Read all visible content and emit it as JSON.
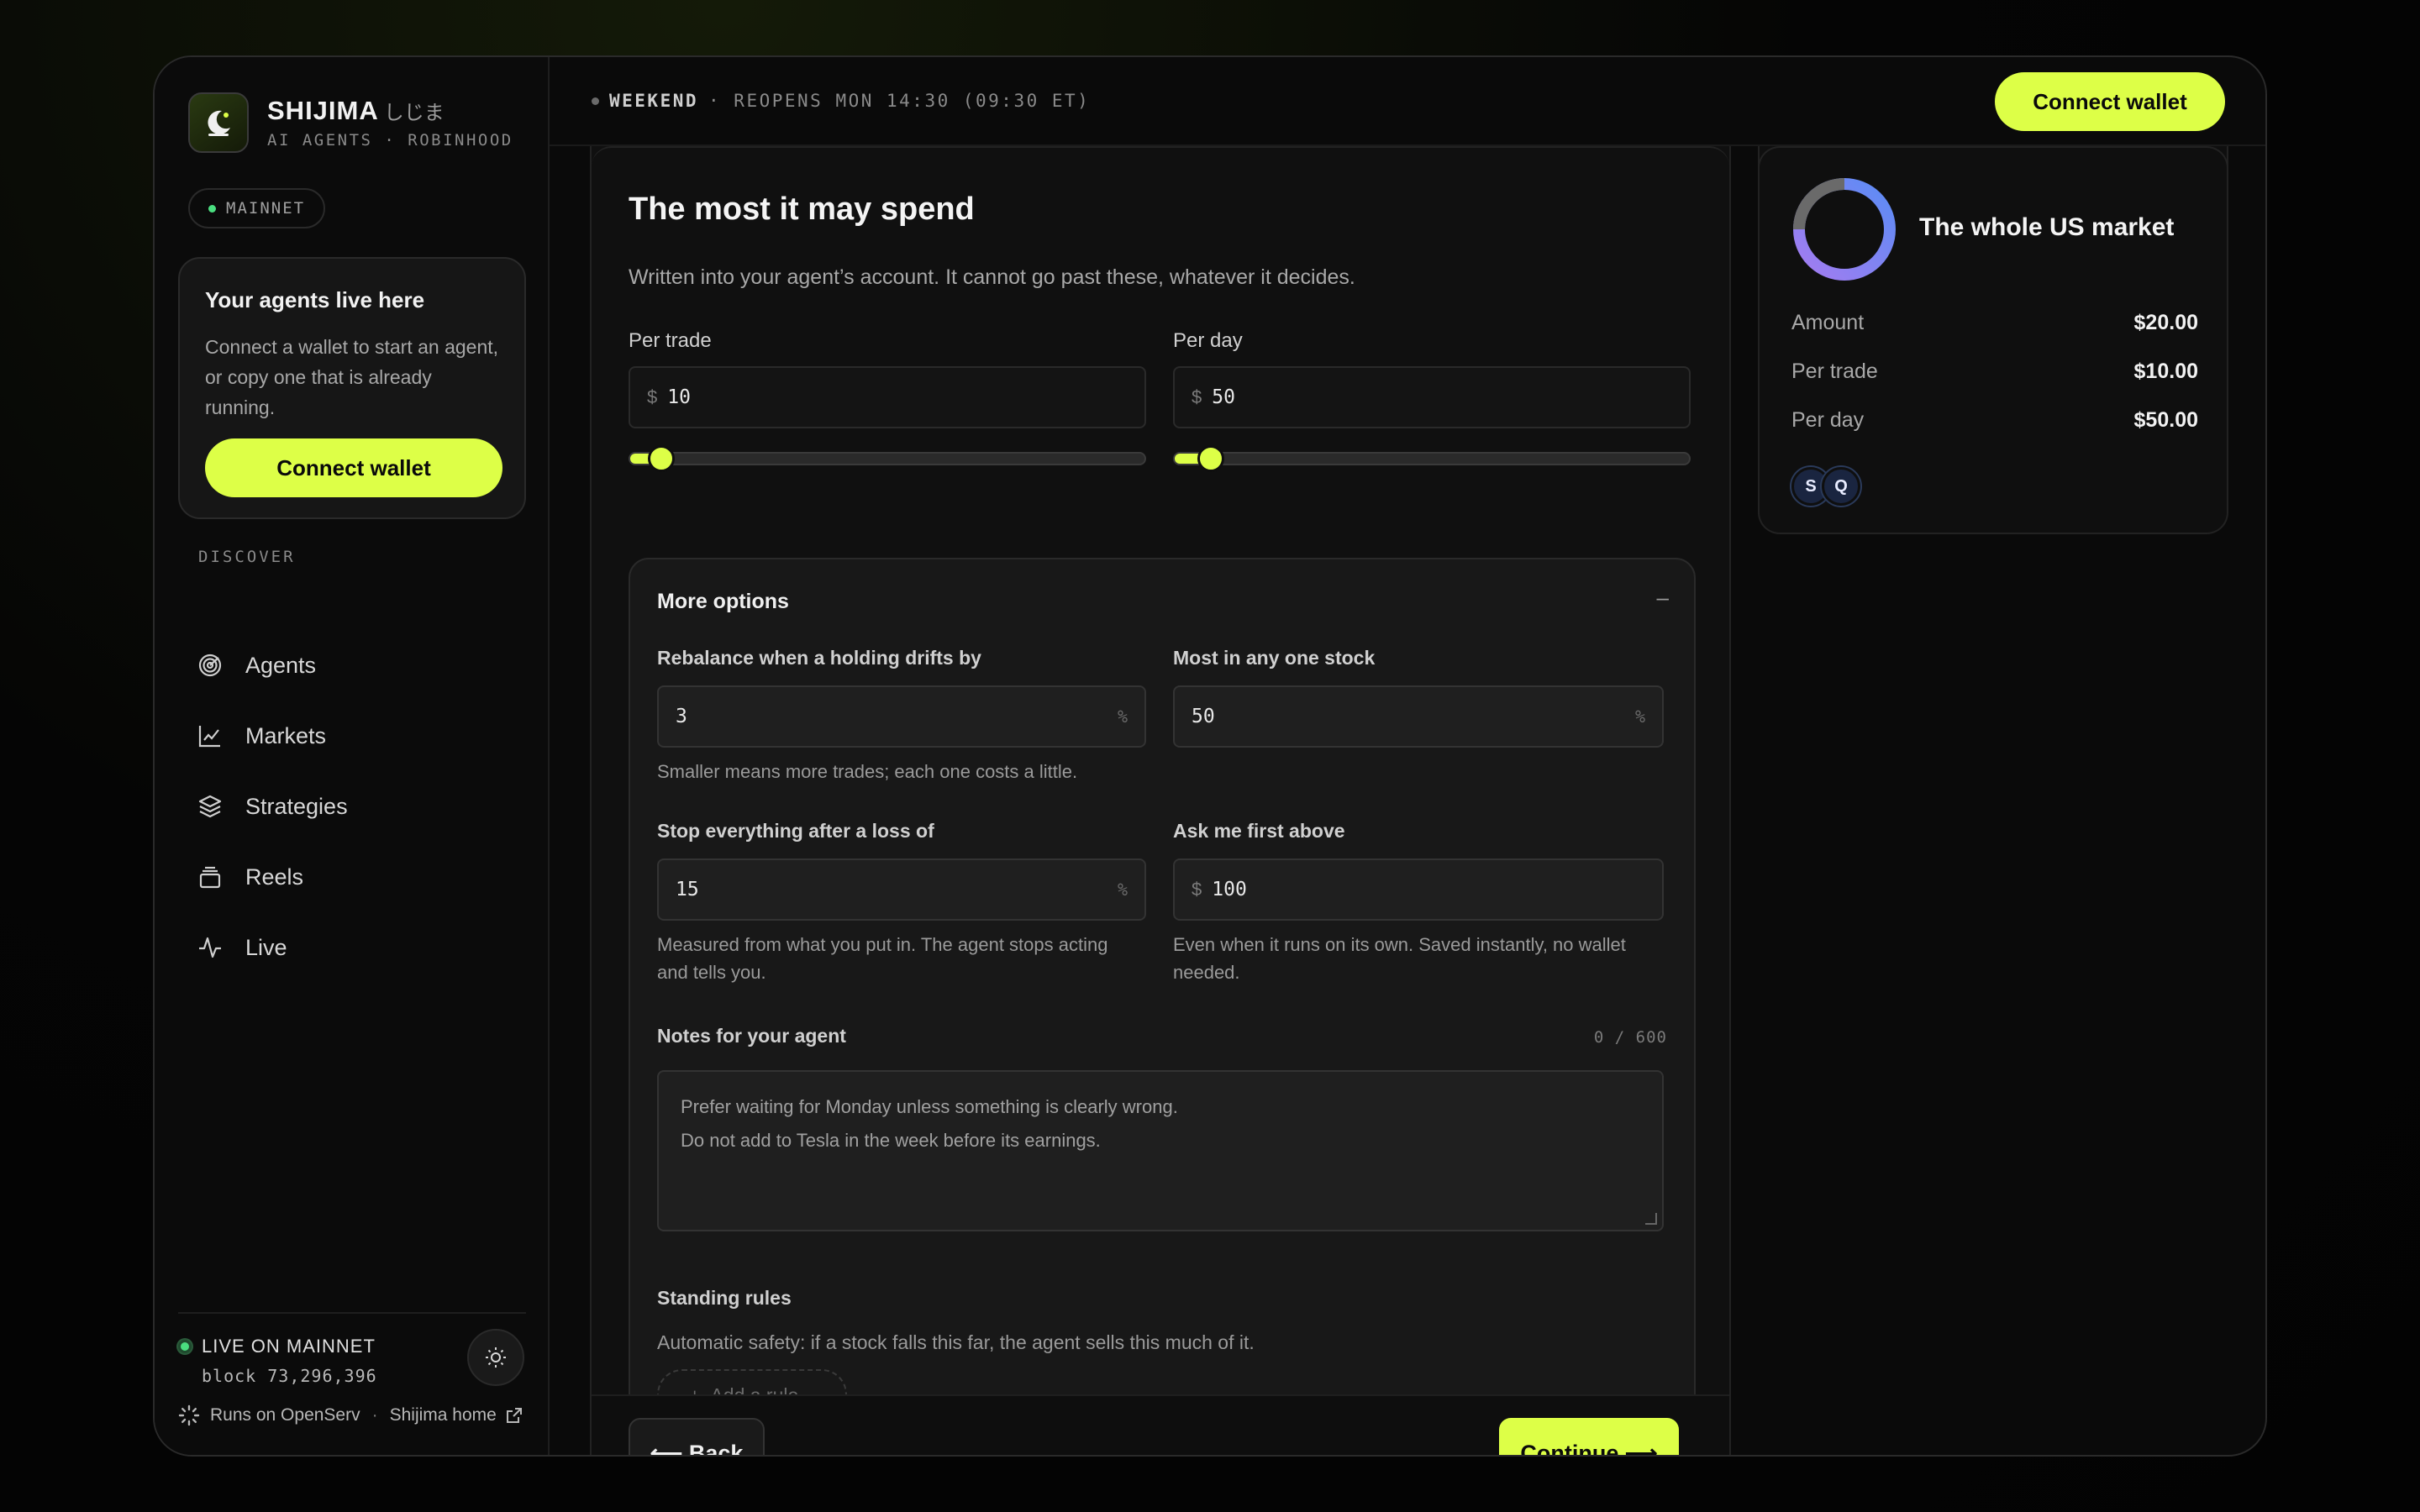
{
  "brand": {
    "name": "SHIJIMA",
    "jp": "しじま",
    "subtitle": "AI AGENTS · ROBINHOOD"
  },
  "network_badge": "MAINNET",
  "welcome": {
    "title": "Your agents live here",
    "text": "Connect a wallet to start an agent, or copy one that is already running.",
    "button": "Connect wallet"
  },
  "nav": {
    "section": "DISCOVER",
    "items": [
      {
        "label": "Agents",
        "icon": "radar-icon"
      },
      {
        "label": "Markets",
        "icon": "line-chart-icon"
      },
      {
        "label": "Strategies",
        "icon": "layers-icon"
      },
      {
        "label": "Reels",
        "icon": "stack-icon"
      },
      {
        "label": "Live",
        "icon": "pulse-icon"
      }
    ]
  },
  "status": {
    "live": "LIVE ON MAINNET",
    "block": "block 73,296,396"
  },
  "footer_links": {
    "openserv": "Runs on OpenServ",
    "home": "Shijima home"
  },
  "topbar": {
    "market_state": "WEEKEND",
    "reopens": "· REOPENS MON 14:30 (09:30 ET)",
    "connect": "Connect wallet"
  },
  "limits": {
    "title": "The most it may spend",
    "subtitle": "Written into your agent’s account. It cannot go past these, whatever it decides.",
    "per_trade": {
      "label": "Per trade",
      "prefix": "$",
      "value": "10",
      "slider_fraction": 0.06
    },
    "per_day": {
      "label": "Per day",
      "prefix": "$",
      "value": "50",
      "slider_fraction": 0.07
    }
  },
  "options": {
    "title": "More options",
    "collapse": "–",
    "rebalance": {
      "label": "Rebalance when a holding drifts by",
      "value": "3",
      "suffix": "%",
      "help": "Smaller means more trades; each one costs a little."
    },
    "max_stock": {
      "label": "Most in any one stock",
      "value": "50",
      "suffix": "%"
    },
    "stop_loss": {
      "label": "Stop everything after a loss of",
      "value": "15",
      "suffix": "%",
      "help": "Measured from what you put in. The agent stops acting and tells you."
    },
    "ask_above": {
      "label": "Ask me first above",
      "prefix": "$",
      "value": "100",
      "help": "Even when it runs on its own. Saved instantly, no wallet needed."
    },
    "notes": {
      "label": "Notes for your agent",
      "counter": "0 / 600",
      "placeholder_line1": "Prefer waiting for Monday unless something is clearly wrong.",
      "placeholder_line2": "Do not add to Tesla in the week before its earnings."
    },
    "standing_rules": {
      "label": "Standing rules",
      "help": "Automatic safety: if a stock falls this far, the agent sells this much of it.",
      "add": "Add a rule"
    }
  },
  "actions": {
    "back": "⟵ Back",
    "continue": "Continue ⟶"
  },
  "summary": {
    "title": "The whole US market",
    "rows": [
      {
        "k": "Amount",
        "v": "$20.00"
      },
      {
        "k": "Per trade",
        "v": "$10.00"
      },
      {
        "k": "Per day",
        "v": "$50.00"
      }
    ],
    "tickers": [
      "S",
      "Q"
    ]
  },
  "colors": {
    "accent": "#ddff47",
    "live": "#4ade80",
    "background": "#0a0a0a"
  }
}
